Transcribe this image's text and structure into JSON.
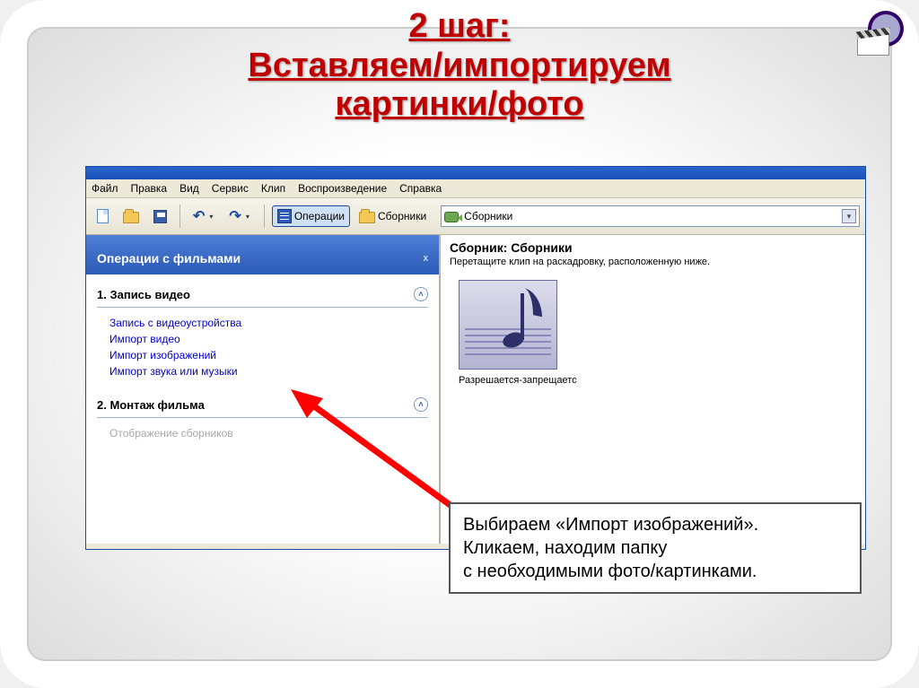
{
  "slide": {
    "title_line1": "2 шаг:",
    "title_line2": "Вставляем/импортируем",
    "title_line3": "картинки/фото"
  },
  "menubar": {
    "items": [
      "Файл",
      "Правка",
      "Вид",
      "Сервис",
      "Клип",
      "Воспроизведение",
      "Справка"
    ]
  },
  "toolbar": {
    "operations_label": "Операции",
    "collections_label": "Сборники",
    "combo_value": "Сборники"
  },
  "taskpane": {
    "header": "Операции с фильмами",
    "close_label": "x",
    "sections": [
      {
        "num": "1.",
        "title": "Запись видео",
        "links": [
          "Запись с видеоустройства",
          "Импорт видео",
          "Импорт изображений",
          "Импорт звука или музыки"
        ]
      },
      {
        "num": "2.",
        "title": "Монтаж фильма",
        "dimmed_links": [
          "Отображение сборников"
        ]
      }
    ]
  },
  "collection": {
    "title": "Сборник: Сборники",
    "subtitle": "Перетащите клип на раскадровку, расположенную ниже.",
    "thumb_label": "Разрешается-запрещаетс"
  },
  "callout": {
    "line1": "Выбираем «Импорт изображений».",
    "line2": "Кликаем, находим папку",
    "line3": "с необходимыми фото/картинками."
  }
}
